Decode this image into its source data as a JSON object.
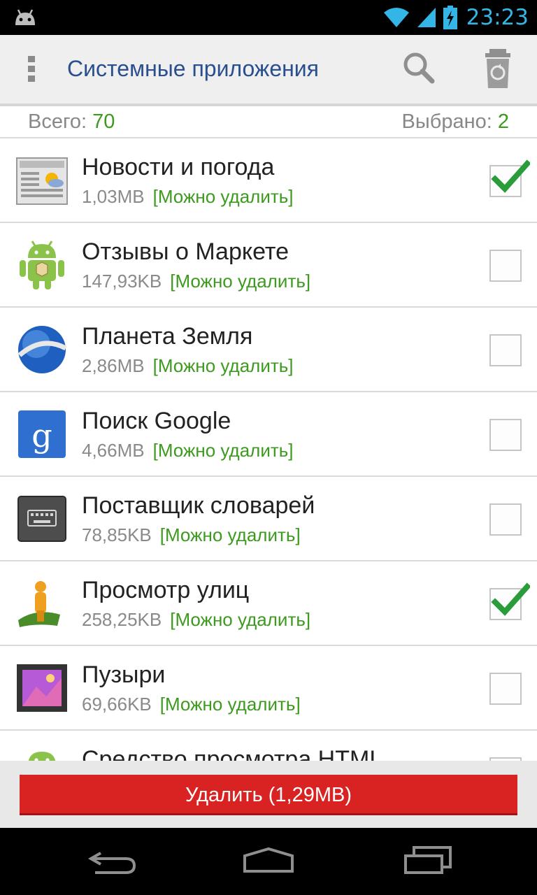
{
  "status_bar": {
    "time": "23:23",
    "icons": [
      "android-icon",
      "wifi-icon",
      "signal-icon",
      "battery-charging-icon"
    ]
  },
  "action_bar": {
    "title": "Системные приложения",
    "icons": [
      "overflow-menu-icon",
      "search-icon",
      "recycle-bin-icon"
    ]
  },
  "summary": {
    "total_label": "Всего:",
    "total_value": "70",
    "selected_label": "Выбрано:",
    "selected_value": "2"
  },
  "apps": [
    {
      "name": "Новости и погода",
      "size": "1,03MB",
      "tag": "[Можно удалить]",
      "checked": true,
      "icon": "news-weather-icon"
    },
    {
      "name": "Отзывы о Маркете",
      "size": "147,93KB",
      "tag": "[Можно удалить]",
      "checked": false,
      "icon": "android-package-icon"
    },
    {
      "name": "Планета Земля",
      "size": "2,86MB",
      "tag": "[Можно удалить]",
      "checked": false,
      "icon": "google-earth-icon"
    },
    {
      "name": "Поиск Google",
      "size": "4,66MB",
      "tag": "[Можно удалить]",
      "checked": false,
      "icon": "google-search-icon"
    },
    {
      "name": "Поставщик словарей",
      "size": "78,85KB",
      "tag": "[Можно удалить]",
      "checked": false,
      "icon": "keyboard-icon"
    },
    {
      "name": "Просмотр улиц",
      "size": "258,25KB",
      "tag": "[Можно удалить]",
      "checked": true,
      "icon": "street-view-icon"
    },
    {
      "name": "Пузыри",
      "size": "69,66KB",
      "tag": "[Можно удалить]",
      "checked": false,
      "icon": "wallpaper-icon"
    },
    {
      "name": "Средство просмотра HTML",
      "size": "",
      "tag": "",
      "checked": false,
      "icon": "android-icon"
    }
  ],
  "delete_button": {
    "label": "Удалить (1,29MB)"
  },
  "nav_bar": {
    "buttons": [
      "back-icon",
      "home-icon",
      "recent-apps-icon"
    ]
  },
  "colors": {
    "accent_title": "#2a4f8e",
    "green": "#3c9a1e",
    "delete": "#d92222",
    "status_time": "#33b5e5"
  }
}
